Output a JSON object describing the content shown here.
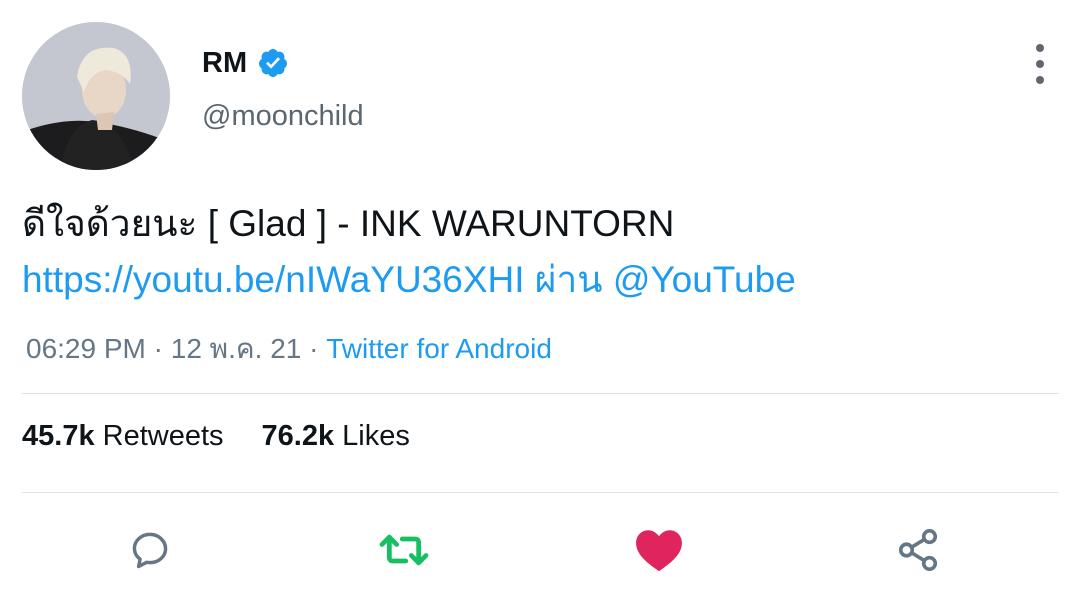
{
  "author": {
    "display_name": "RM",
    "handle": "@moonchild",
    "verified_icon": "verified-badge-icon",
    "avatar": "avatar"
  },
  "tweet": {
    "text": "ดีใจด้วยนะ [ Glad ] - INK WARUNTORN",
    "link_url": "https://youtu.be/nIWaYU36XHI",
    "via_word": "ผ่าน",
    "mention": "@YouTube",
    "time": "06:29 PM",
    "date": "12 พ.ค. 21",
    "separator": "·",
    "source": "Twitter for Android"
  },
  "stats": {
    "retweets_count": "45.7k",
    "retweets_label": "Retweets",
    "likes_count": "76.2k",
    "likes_label": "Likes"
  },
  "actions": [
    {
      "name": "reply",
      "icon": "reply-icon"
    },
    {
      "name": "retweet",
      "icon": "retweet-icon",
      "color": "#17bf63"
    },
    {
      "name": "like",
      "icon": "heart-icon",
      "color": "#e0245e"
    },
    {
      "name": "share",
      "icon": "share-icon"
    }
  ],
  "colors": {
    "link": "#1d9bf0",
    "verified": "#1d9bf0",
    "muted": "#657786",
    "retweet_active": "#17bf63",
    "like_active": "#e0245e"
  }
}
